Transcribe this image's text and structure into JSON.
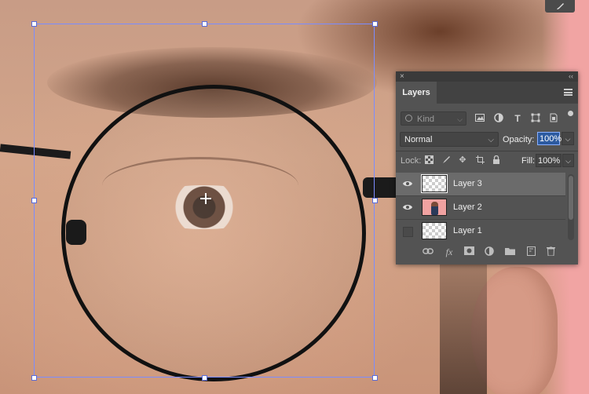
{
  "toolbar": {
    "brush_icon": "brush-icon"
  },
  "panel": {
    "close": "×",
    "collapse": "‹‹",
    "tab": "Layers",
    "filter": {
      "placeholder": "Kind"
    },
    "blend_mode": "Normal",
    "opacity_label": "Opacity:",
    "opacity_value": "100%",
    "lock_label": "Lock:",
    "fill_label": "Fill:",
    "fill_value": "100%",
    "layers": [
      {
        "name": "Layer 3",
        "visible": true,
        "selected": true
      },
      {
        "name": "Layer 2",
        "visible": true,
        "selected": false
      },
      {
        "name": "Layer 1",
        "visible": false,
        "selected": false
      }
    ]
  },
  "colors": {
    "selection_box": "#7b8cff",
    "panel_bg": "#535353",
    "opacity_highlight": "#2c5aa0",
    "canvas_pink": "#f1a4a3"
  }
}
